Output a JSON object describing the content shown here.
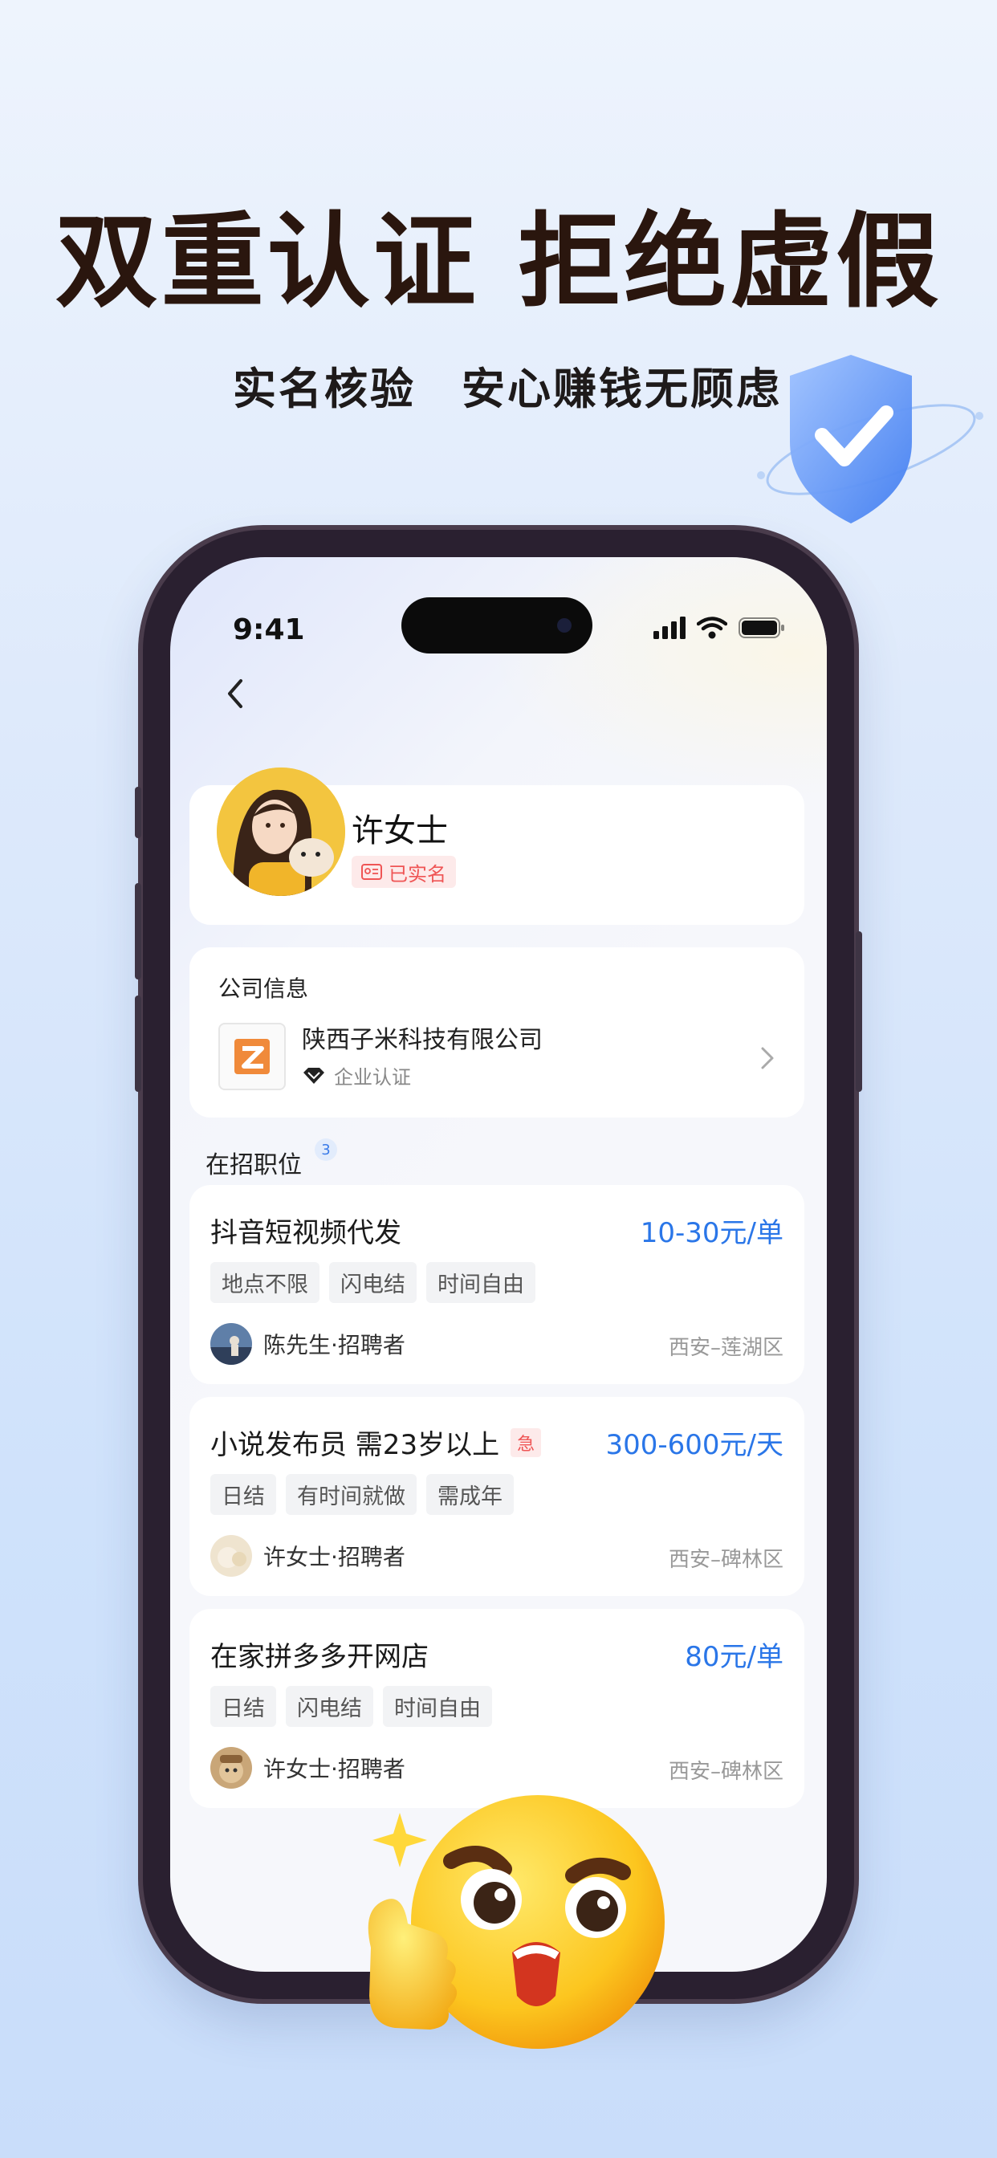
{
  "promo": {
    "headline": "双重认证 拒绝虚假",
    "subline": "实名核验　安心赚钱无顾虑"
  },
  "status_bar": {
    "time": "9:41"
  },
  "profile": {
    "name": "许女士",
    "badge": "已实名"
  },
  "company": {
    "section_title": "公司信息",
    "name": "陕西子米科技有限公司",
    "certification": "企业认证"
  },
  "jobs_section": {
    "title": "在招职位",
    "count": "3"
  },
  "jobs": [
    {
      "title": "抖音短视频代发",
      "urgent": "",
      "salary": "10-30元/单",
      "tags": [
        "地点不限",
        "闪电结",
        "时间自由"
      ],
      "recruiter": "陈先生·招聘者",
      "location": "西安–莲湖区"
    },
    {
      "title": "小说发布员 需23岁以上",
      "urgent": "急",
      "salary": "300-600元/天",
      "tags": [
        "日结",
        "有时间就做",
        "需成年"
      ],
      "recruiter": "许女士·招聘者",
      "location": "西安–碑林区"
    },
    {
      "title": "在家拼多多开网店",
      "urgent": "",
      "salary": "80元/单",
      "tags": [
        "日结",
        "闪电结",
        "时间自由"
      ],
      "recruiter": "许女士·招聘者",
      "location": "西安–碑林区"
    }
  ],
  "colors": {
    "accent": "#2a76e8",
    "headline": "#2a160e",
    "badge_red": "#ef5555"
  },
  "icons": [
    "shield-check-icon",
    "back-arrow-icon",
    "signal-icon",
    "wifi-icon",
    "battery-icon",
    "id-card-icon",
    "diamond-icon",
    "chevron-right-icon",
    "thumbs-up-emoji-icon"
  ]
}
